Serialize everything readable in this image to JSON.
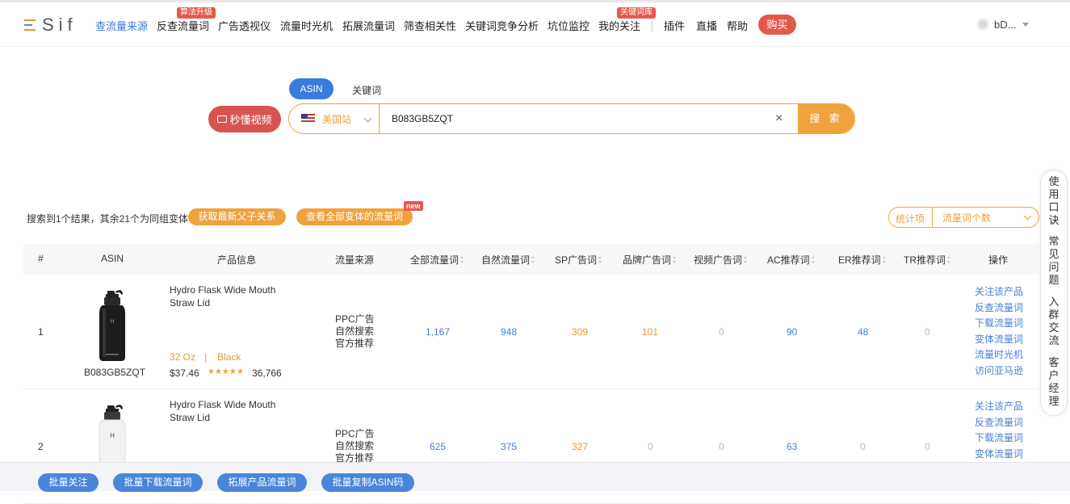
{
  "logo": "Sif",
  "nav": {
    "items": [
      {
        "label": "查流量来源",
        "active": true
      },
      {
        "label": "反查流量词",
        "badge": "算法升级"
      },
      {
        "label": "广告透视仪"
      },
      {
        "label": "流量时光机"
      },
      {
        "label": "拓展流量词"
      },
      {
        "label": "筛查相关性"
      },
      {
        "label": "关键词竞争分析"
      },
      {
        "label": "坑位监控"
      },
      {
        "label": "我的关注",
        "badge": "关键词库"
      },
      {
        "label": "插件"
      },
      {
        "label": "直播"
      },
      {
        "label": "帮助"
      }
    ],
    "buy": "购买",
    "user": "bD..."
  },
  "search": {
    "tabs": [
      "ASIN",
      "关键词"
    ],
    "video_button": "秒懂视频",
    "site": "美国站",
    "value": "B083GB5ZQT",
    "clear": "×",
    "button": "搜 索"
  },
  "results": {
    "summary": "搜索到1个结果，其余21个为同组变体",
    "btn_parent": "获取最新父子关系",
    "btn_variants": "查看全部变体的流量词",
    "new_badge": "new",
    "stat_label": "统计项",
    "stat_value": "流量词个数"
  },
  "table": {
    "headers": [
      "#",
      "ASIN",
      "产品信息",
      "流量来源",
      "全部流量词",
      "自然流量词",
      "SP广告词",
      "品牌广告词",
      "视频广告词",
      "AC推荐词",
      "ER推荐词",
      "TR推荐词",
      "操作"
    ],
    "rows": [
      {
        "index": "1",
        "asin": "B083GB5ZQT",
        "title": "Hydro Flask Wide Mouth Straw Lid",
        "size": "32 Oz",
        "sep": "|",
        "color": "Black",
        "price": "$37.46",
        "stars": "★★★★★",
        "reviews": "36,766",
        "sources": [
          "PPC广告",
          "自然搜索",
          "官方推荐"
        ],
        "all": "1,167",
        "natural": "948",
        "sp": "309",
        "brand": "101",
        "video": "0",
        "ac": "90",
        "er": "48",
        "tr": "0",
        "ops": [
          "关注该产品",
          "反查流量词",
          "下载流量词",
          "变体流量词",
          "流量时光机",
          "访问亚马逊"
        ]
      },
      {
        "index": "2",
        "asin": "",
        "title": "Hydro Flask Wide Mouth Straw Lid",
        "sources": [
          "PPC广告",
          "自然搜索",
          "官方推荐"
        ],
        "all": "625",
        "natural": "375",
        "sp": "327",
        "brand": "0",
        "video": "0",
        "ac": "63",
        "er": "0",
        "tr": "0",
        "ops": [
          "关注该产品",
          "反查流量词",
          "下载流量词",
          "变体流量词"
        ]
      }
    ]
  },
  "bottom_buttons": [
    "批量关注",
    "批量下载流量词",
    "拓展产品流量词",
    "批量复制ASIN码"
  ],
  "side": {
    "groups": [
      [
        "使",
        "用",
        "口",
        "诀"
      ],
      [
        "常",
        "见",
        "问",
        "题"
      ],
      [
        "入",
        "群",
        "交",
        "流"
      ],
      [
        "客",
        "户",
        "经",
        "理"
      ]
    ]
  },
  "colors": {
    "accent_blue": "#3a7bdc",
    "accent_orange": "#f0a23c",
    "red": "#e35a4b"
  }
}
